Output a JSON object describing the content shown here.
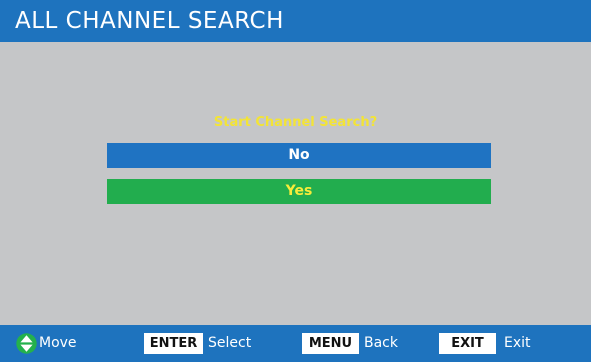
{
  "header": {
    "title": "ALL CHANNEL SEARCH"
  },
  "dialog": {
    "prompt": "Start Channel Search?",
    "options": [
      {
        "label": "No",
        "selected": false
      },
      {
        "label": "Yes",
        "selected": true
      }
    ]
  },
  "footer": {
    "move_label": "Move",
    "enter_key": "ENTER",
    "enter_label": "Select",
    "menu_key": "MENU",
    "menu_label": "Back",
    "exit_key": "EXIT",
    "exit_label": "Exit"
  },
  "colors": {
    "header_bar": "#1e73be",
    "background": "#c5c6c8",
    "prompt_text": "#f3e436",
    "option_no": "#1f73c2",
    "option_yes_highlight": "#22ad4e",
    "highlight_text": "#f7ec3a"
  }
}
